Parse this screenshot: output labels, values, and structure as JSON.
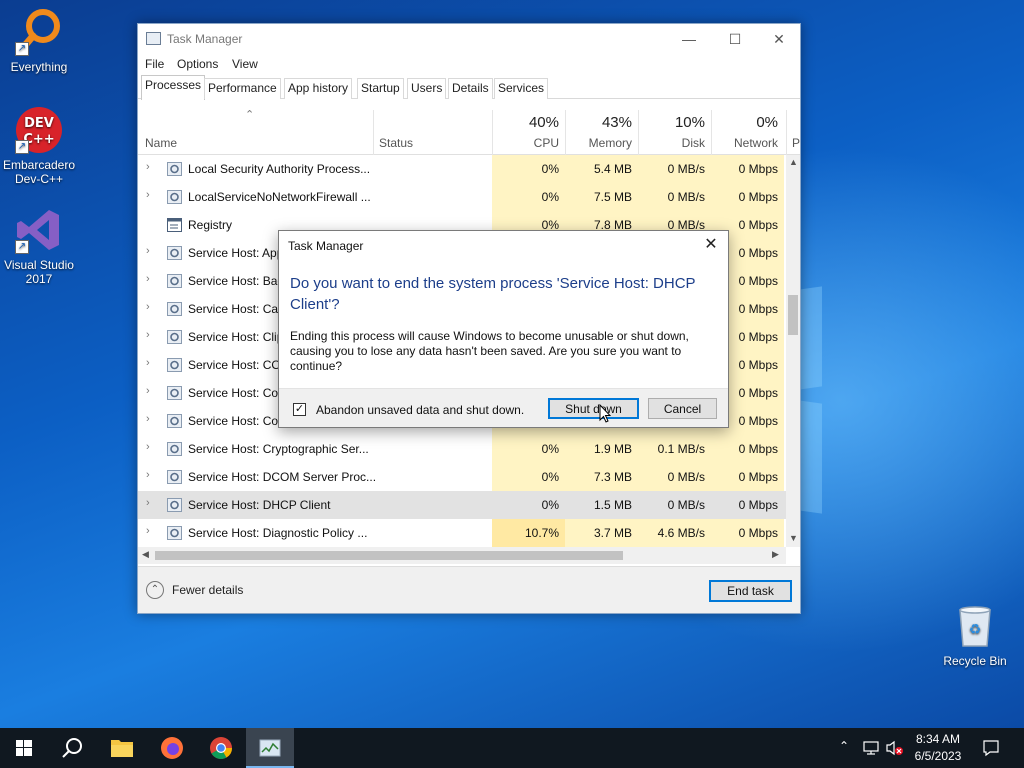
{
  "desktop": {
    "icons": [
      {
        "label": "Everything"
      },
      {
        "label": "Embarcadero Dev-C++"
      },
      {
        "label": "Visual Studio 2017"
      },
      {
        "label": "Recycle Bin"
      }
    ]
  },
  "task_manager": {
    "title": "Task Manager",
    "menu": [
      "File",
      "Options",
      "View"
    ],
    "tabs": [
      "Processes",
      "Performance",
      "App history",
      "Startup",
      "Users",
      "Details",
      "Services"
    ],
    "active_tab": "Processes",
    "columns": {
      "name": "Name",
      "status": "Status",
      "cpu": {
        "pct": "40%",
        "label": "CPU"
      },
      "memory": {
        "pct": "43%",
        "label": "Memory"
      },
      "disk": {
        "pct": "10%",
        "label": "Disk"
      },
      "network": {
        "pct": "0%",
        "label": "Network"
      },
      "power_partial": "P"
    },
    "rows": [
      {
        "name": "Local Security Authority Process...",
        "cpu": "0%",
        "memory": "5.4 MB",
        "disk": "0 MB/s",
        "network": "0 Mbps",
        "expandable": true
      },
      {
        "name": "LocalServiceNoNetworkFirewall ...",
        "cpu": "0%",
        "memory": "7.5 MB",
        "disk": "0 MB/s",
        "network": "0 Mbps",
        "expandable": true
      },
      {
        "name": "Registry",
        "cpu": "0%",
        "memory": "7.8 MB",
        "disk": "0 MB/s",
        "network": "0 Mbps",
        "expandable": false
      },
      {
        "name": "Service Host: App",
        "cpu": "",
        "memory": "",
        "disk": "",
        "network": "0 Mbps",
        "expandable": true
      },
      {
        "name": "Service Host: Bac",
        "cpu": "",
        "memory": "",
        "disk": "",
        "network": "0 Mbps",
        "expandable": true
      },
      {
        "name": "Service Host: Cap",
        "cpu": "",
        "memory": "",
        "disk": "",
        "network": "0 Mbps",
        "expandable": true
      },
      {
        "name": "Service Host: Clip",
        "cpu": "",
        "memory": "",
        "disk": "",
        "network": "0 Mbps",
        "expandable": true
      },
      {
        "name": "Service Host: CO",
        "cpu": "",
        "memory": "",
        "disk": "",
        "network": "0 Mbps",
        "expandable": true
      },
      {
        "name": "Service Host: Cor",
        "cpu": "",
        "memory": "",
        "disk": "",
        "network": "0 Mbps",
        "expandable": true
      },
      {
        "name": "Service Host: Cor",
        "cpu": "",
        "memory": "",
        "disk": "",
        "network": "0 Mbps",
        "expandable": true
      },
      {
        "name": "Service Host: Cryptographic Ser...",
        "cpu": "0%",
        "memory": "1.9 MB",
        "disk": "0.1 MB/s",
        "network": "0 Mbps",
        "expandable": true
      },
      {
        "name": "Service Host: DCOM Server Proc...",
        "cpu": "0%",
        "memory": "7.3 MB",
        "disk": "0 MB/s",
        "network": "0 Mbps",
        "expandable": true
      },
      {
        "name": "Service Host: DHCP Client",
        "cpu": "0%",
        "memory": "1.5 MB",
        "disk": "0 MB/s",
        "network": "0 Mbps",
        "expandable": true,
        "selected": true
      },
      {
        "name": "Service Host: Diagnostic Policy ...",
        "cpu": "10.7%",
        "memory": "3.7 MB",
        "disk": "4.6 MB/s",
        "network": "0 Mbps",
        "expandable": true
      }
    ],
    "footer": {
      "fewer_details": "Fewer details",
      "end_task": "End task"
    }
  },
  "dialog": {
    "title": "Task Manager",
    "heading": "Do you want to end the system process 'Service Host: DHCP Client'?",
    "body": "Ending this process will cause Windows to become unusable or shut down, causing you to lose any data hasn't been saved. Are you sure you want to continue?",
    "checkbox_label": "Abandon unsaved data and shut down.",
    "checkbox_checked": true,
    "shutdown_button": "Shut down",
    "cancel_button": "Cancel"
  },
  "taskbar": {
    "time": "8:34 AM",
    "date": "6/5/2023"
  },
  "colors": {
    "accent": "#0078d7",
    "heat_low": "#fff4c4",
    "heat_mid": "#ffe9a3",
    "dialog_heading": "#1c3e8a"
  }
}
